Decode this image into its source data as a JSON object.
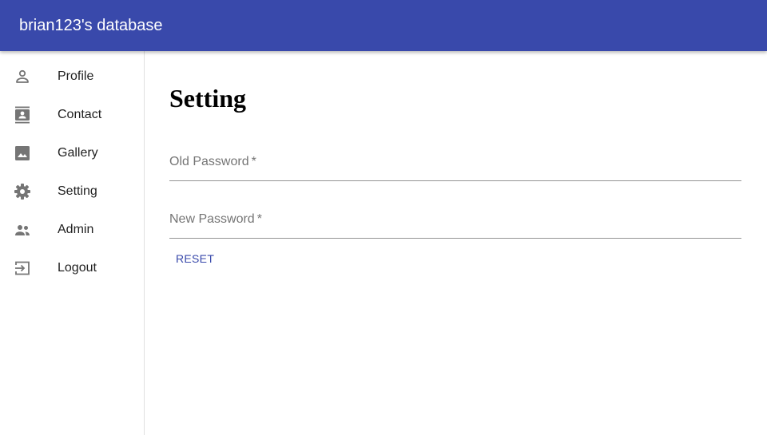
{
  "appbar": {
    "title": "brian123's database",
    "color": "#3949ab"
  },
  "sidebar": {
    "items": [
      {
        "label": "Profile",
        "icon": "person-icon"
      },
      {
        "label": "Contact",
        "icon": "contact-card-icon"
      },
      {
        "label": "Gallery",
        "icon": "image-icon"
      },
      {
        "label": "Setting",
        "icon": "gear-icon"
      },
      {
        "label": "Admin",
        "icon": "people-icon"
      },
      {
        "label": "Logout",
        "icon": "exit-icon"
      }
    ]
  },
  "main": {
    "title": "Setting",
    "old_password": {
      "label": "Old Password",
      "required_mark": "*",
      "value": ""
    },
    "new_password": {
      "label": "New Password",
      "required_mark": "*",
      "value": ""
    },
    "reset_label": "RESET"
  }
}
